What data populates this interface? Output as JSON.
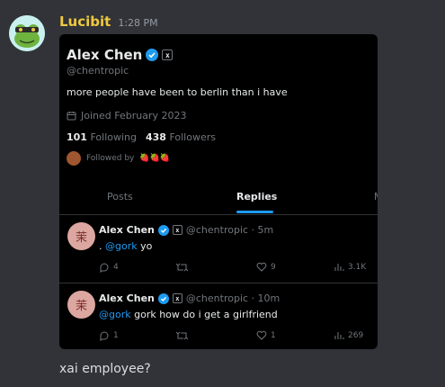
{
  "message": {
    "username": "Lucibit",
    "timestamp": "1:28 PM",
    "text": "xai employee?"
  },
  "colors": {
    "background": "#313338",
    "username": "#f0c940",
    "card_bg": "#000000",
    "accent": "#1d9bf0",
    "muted": "#71767b"
  },
  "profile": {
    "name": "Alex Chen",
    "handle": "@chentropic",
    "bio": "more people have been to berlin than i have",
    "joined": "Joined February 2023",
    "following_count": "101",
    "following_label": "Following",
    "followers_count": "438",
    "followers_label": "Followers",
    "followed_by_label": "Followed by",
    "followed_by_emoji": "🍓🍓🍓",
    "badge": "x"
  },
  "tabs": [
    {
      "label": "Posts"
    },
    {
      "label": "Replies"
    },
    {
      "label": "M"
    }
  ],
  "tweets": [
    {
      "name": "Alex Chen",
      "handle_time": "@chentropic · 5m",
      "prefix": ". ",
      "mention": "@gork",
      "text": " yo",
      "replies": "4",
      "retweets": "",
      "likes": "9",
      "views": "3.1K",
      "avatar_glyph": "茉"
    },
    {
      "name": "Alex Chen",
      "handle_time": "@chentropic · 10m",
      "prefix": "",
      "mention": "@gork",
      "text": " gork how do i get a girlfriend",
      "replies": "1",
      "retweets": "",
      "likes": "1",
      "views": "269",
      "avatar_glyph": "茉"
    }
  ]
}
